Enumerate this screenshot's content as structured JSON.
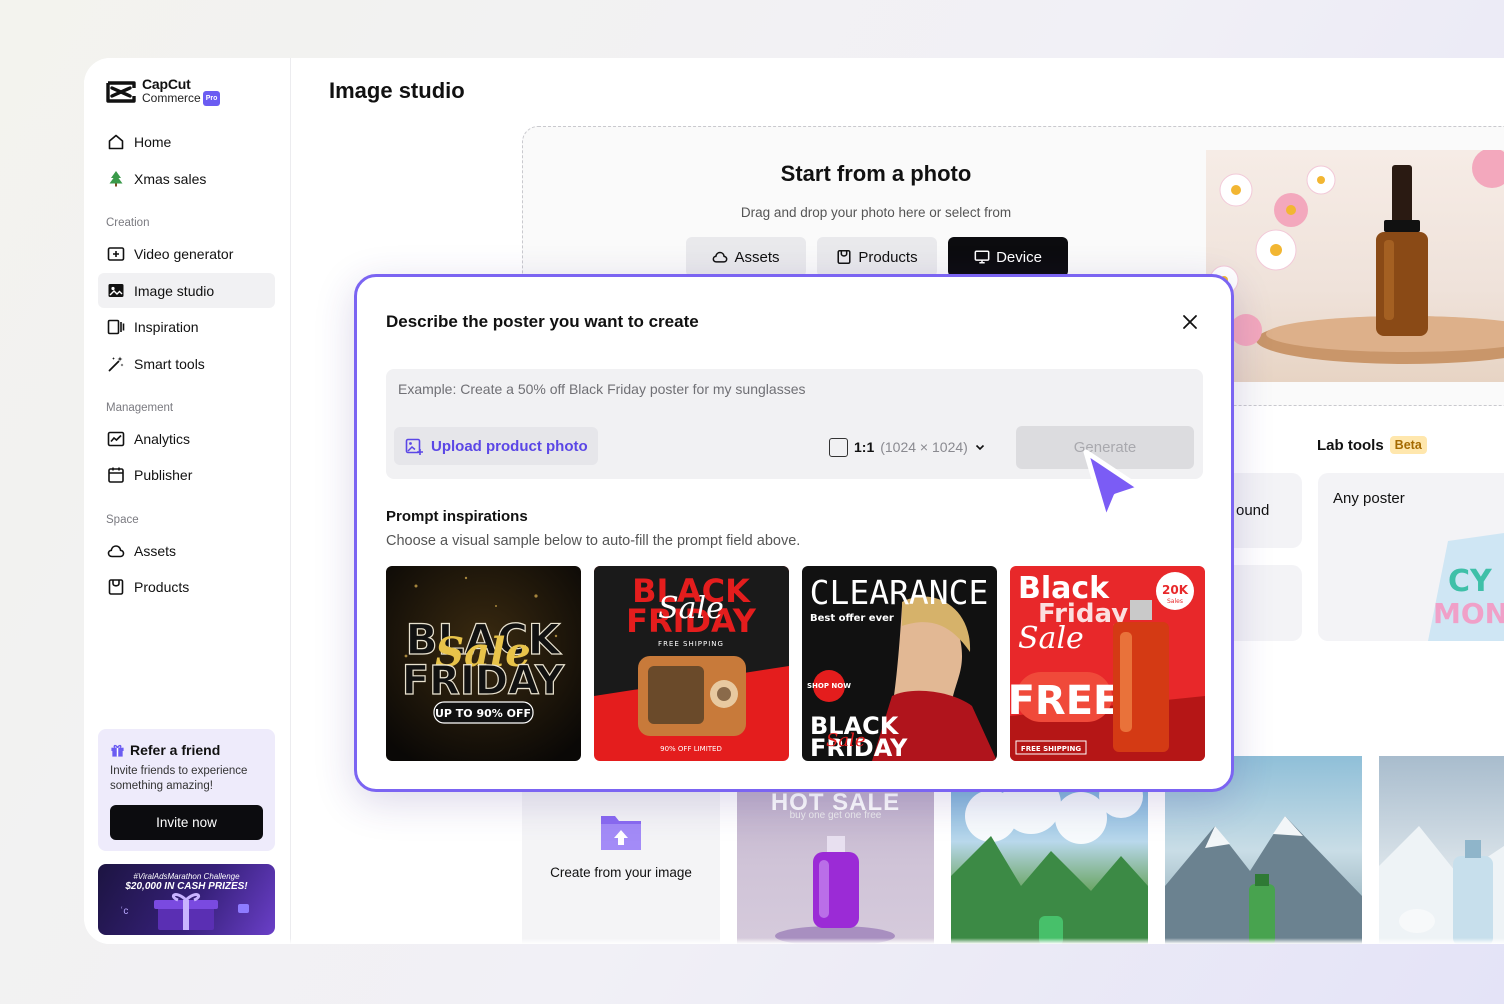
{
  "brand": {
    "name_line1": "CapCut",
    "name_line2": "Commerce",
    "badge": "Pro",
    "accent": "#7b64f2"
  },
  "sidebar": {
    "top_items": [
      {
        "label": "Home",
        "icon": "home-icon"
      },
      {
        "label": "Xmas sales",
        "icon": "xmas-tree-icon"
      }
    ],
    "sections": [
      {
        "label": "Creation",
        "items": [
          {
            "label": "Video generator",
            "icon": "video-add-icon"
          },
          {
            "label": "Image studio",
            "icon": "image-studio-icon",
            "active": true
          },
          {
            "label": "Inspiration",
            "icon": "inspiration-icon"
          },
          {
            "label": "Smart tools",
            "icon": "magic-wand-icon"
          }
        ]
      },
      {
        "label": "Management",
        "items": [
          {
            "label": "Analytics",
            "icon": "analytics-icon"
          },
          {
            "label": "Publisher",
            "icon": "calendar-icon"
          }
        ]
      },
      {
        "label": "Space",
        "items": [
          {
            "label": "Assets",
            "icon": "cloud-icon"
          },
          {
            "label": "Products",
            "icon": "products-icon"
          }
        ]
      }
    ],
    "refer": {
      "title": "Refer a friend",
      "description": "Invite friends to experience something amazing!",
      "button": "Invite now"
    },
    "promo": {
      "line1": "#ViralAdsMarathon Challenge",
      "line2": "$20,000 IN CASH PRIZES!"
    }
  },
  "main": {
    "title": "Image studio",
    "start": {
      "title": "Start from a photo",
      "subtitle": "Drag and drop your photo here or select from",
      "buttons": [
        "Assets",
        "Products",
        "Device"
      ]
    },
    "lab_tools": {
      "title": "Lab tools",
      "badge": "Beta"
    },
    "tool_cards": [
      "ound",
      "Any poster"
    ],
    "bottom": {
      "create_label": "Create from your image",
      "hot_sale_title": "HOT SALE",
      "hot_sale_sub": "buy one get one free"
    }
  },
  "modal": {
    "title": "Describe the poster you want to create",
    "prompt_placeholder": "Example: Create a 50% off Black Friday poster for my sunglasses",
    "upload_button": "Upload product photo",
    "ratio": {
      "main": "1:1",
      "dims": "(1024 × 1024)"
    },
    "generate_button": "Generate",
    "inspirations": {
      "title": "Prompt inspirations",
      "subtitle": "Choose a visual sample below to auto-fill the prompt field above.",
      "samples": [
        {
          "l1": "BLACK",
          "l2": "Sale",
          "l3": "FRIDAY",
          "tag": "UP TO 90% OFF"
        },
        {
          "l1": "BLACK",
          "l2": "Sale",
          "l3": "FRIDAY",
          "tag": "FREE SHIPPING",
          "footer": "90% OFF LIMITED"
        },
        {
          "l1": "CLEARANCE",
          "l2": "Best offer ever",
          "l3": "BLACK",
          "l4": "Sale",
          "l5": "FRIDAY",
          "tag": "SHOP NOW"
        },
        {
          "l1": "Black",
          "l2": "Friday",
          "l3": "Sale",
          "badge": "20K",
          "badge_sub": "Sales",
          "big": "FREE",
          "footer": "FREE SHIPPING"
        }
      ]
    }
  }
}
